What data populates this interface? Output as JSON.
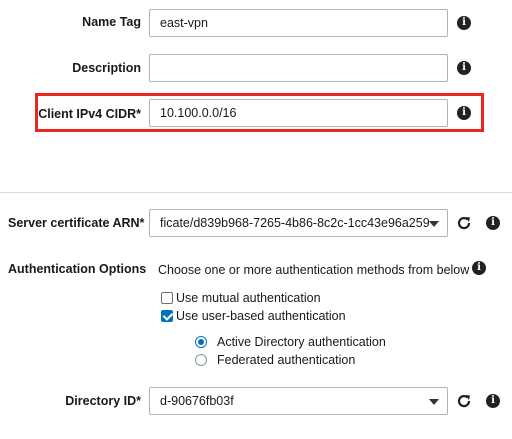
{
  "form": {
    "name_tag": {
      "label": "Name Tag",
      "value": "east-vpn"
    },
    "description": {
      "label": "Description",
      "value": ""
    },
    "client_cidr": {
      "label": "Client IPv4 CIDR*",
      "value": "10.100.0.0/16"
    },
    "server_cert": {
      "label": "Server certificate ARN*",
      "value": "ficate/d839b968-7265-4b86-8c2c-1cc43e96a259"
    },
    "auth": {
      "label": "Authentication Options",
      "hint": "Choose one or more authentication methods from below",
      "mutual": {
        "label": "Use mutual authentication",
        "checked": false
      },
      "user_based": {
        "label": "Use user-based authentication",
        "checked": true
      },
      "active_directory": {
        "label": "Active Directory authentication",
        "selected": true
      },
      "federated": {
        "label": "Federated authentication",
        "selected": false
      }
    },
    "directory_id": {
      "label": "Directory ID*",
      "value": "d-90676fb03f"
    }
  },
  "icons": {
    "info_glyph": "i",
    "highlight_color": "#e8271d",
    "accent_color": "#0073bb"
  }
}
